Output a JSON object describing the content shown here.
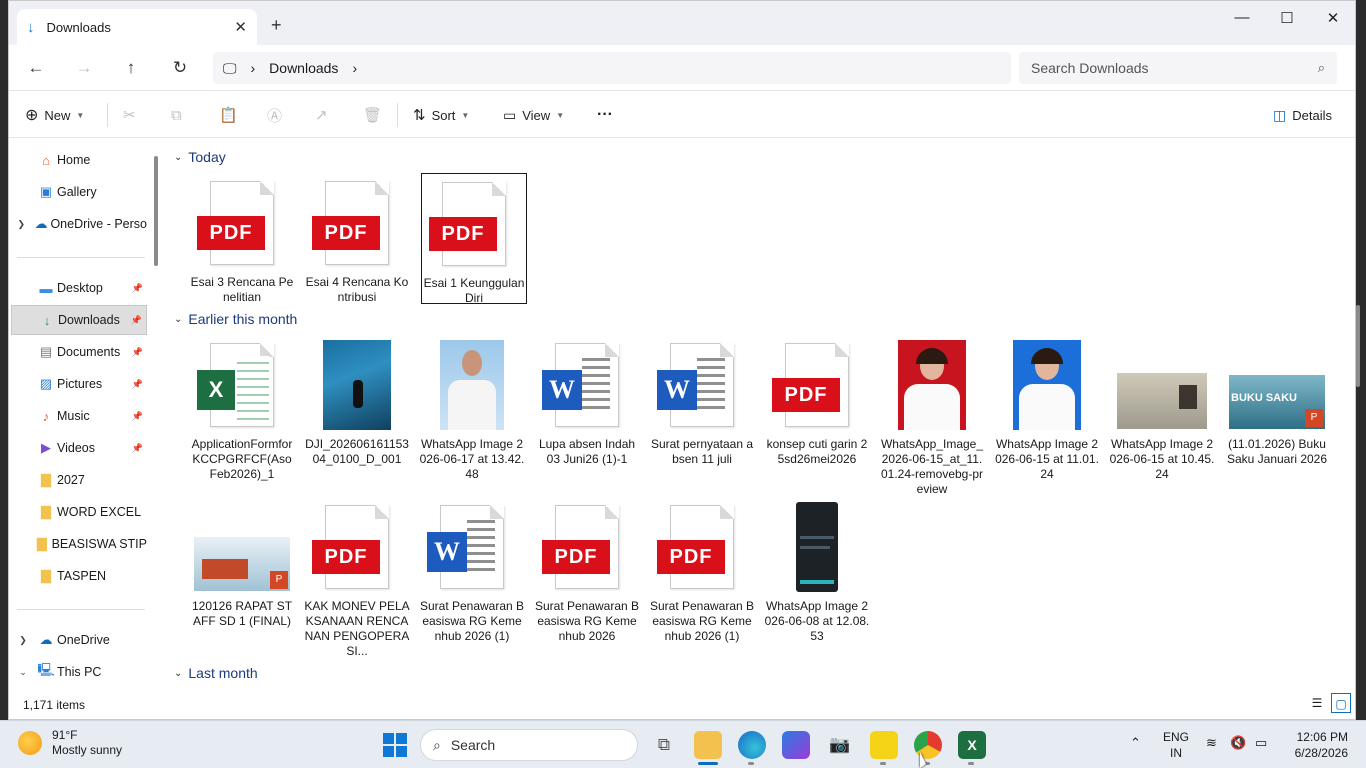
{
  "window": {
    "tab_title": "Downloads",
    "new_tab_icon": "plus-icon",
    "controls": [
      "minimize",
      "maximize",
      "close"
    ]
  },
  "address": {
    "breadcrumb": [
      "Downloads"
    ],
    "search_placeholder": "Search Downloads"
  },
  "toolbar": {
    "new_label": "New",
    "sort_label": "Sort",
    "view_label": "View",
    "details_label": "Details",
    "more_label": "···"
  },
  "sidebar": {
    "items": [
      {
        "label": "Home",
        "icon": "home-icon",
        "color": "#e0662f"
      },
      {
        "label": "Gallery",
        "icon": "gallery-icon",
        "color": "#2a7fd4"
      },
      {
        "label": "OneDrive - Perso",
        "icon": "cloud-icon",
        "color": "#0f6cbd"
      },
      {
        "label": "Desktop",
        "icon": "desktop-icon",
        "color": "#3b8fe0"
      },
      {
        "label": "Downloads",
        "icon": "download-icon",
        "color": "#1f9c56"
      },
      {
        "label": "Documents",
        "icon": "documents-icon",
        "color": "#6c7a8a"
      },
      {
        "label": "Pictures",
        "icon": "pictures-icon",
        "color": "#2d7fd6"
      },
      {
        "label": "Music",
        "icon": "music-icon",
        "color": "#e05a3d"
      },
      {
        "label": "Videos",
        "icon": "videos-icon",
        "color": "#7a4fd1"
      },
      {
        "label": "2027",
        "icon": "folder-icon",
        "color": "#f2c14e"
      },
      {
        "label": "WORD EXCEL",
        "icon": "folder-icon",
        "color": "#f2c14e"
      },
      {
        "label": "BEASISWA STIP",
        "icon": "folder-icon",
        "color": "#f2c14e"
      },
      {
        "label": "TASPEN",
        "icon": "folder-icon",
        "color": "#f2c14e"
      },
      {
        "label": "OneDrive",
        "icon": "cloud-icon",
        "color": "#0f6cbd"
      },
      {
        "label": "This PC",
        "icon": "pc-icon",
        "color": "#2d7fd6"
      }
    ]
  },
  "groups": {
    "today": "Today",
    "earlier": "Earlier this month",
    "last": "Last month"
  },
  "files": {
    "today": [
      {
        "name": "Esai 3 Rencana Penelitian",
        "type": "pdf"
      },
      {
        "name": "Esai 4 Rencana Kontribusi",
        "type": "pdf"
      },
      {
        "name": "Esai 1 Keunggulan Diri",
        "type": "pdf",
        "selected": true
      }
    ],
    "earlier_row1": [
      {
        "name": "ApplicationFormforKCCPGRFCF(AsoFeb2026)_1",
        "type": "xlsx"
      },
      {
        "name": "DJI_20260616115304_0100_D_001",
        "type": "photo-pool"
      },
      {
        "name": "WhatsApp Image 2026-06-17 at 13.42.48",
        "type": "photo-uniform"
      },
      {
        "name": "Lupa absen Indah 03 Juni26 (1)-1",
        "type": "docx"
      },
      {
        "name": "Surat pernyataan absen 11 juli",
        "type": "docx"
      },
      {
        "name": "konsep cuti garin 25sd26mei2026",
        "type": "pdf"
      },
      {
        "name": "WhatsApp_Image_2026-06-15_at_11.01.24-removebg-preview",
        "type": "photo-red"
      },
      {
        "name": "WhatsApp Image 2026-06-15 at 11.01.24",
        "type": "photo-blue"
      },
      {
        "name": "WhatsApp Image 2026-06-15 at 10.45.24",
        "type": "photo-card"
      },
      {
        "name": "(11.01.2026) Buku Saku Januari 2026",
        "type": "pptx-book"
      }
    ],
    "earlier_row2": [
      {
        "name": "120126 RAPAT STAFF SD 1 (FINAL)",
        "type": "pptx-ship"
      },
      {
        "name": "KAK MONEV PELAKSANAAN RENCANAN PENGOPERASI...",
        "type": "pdf"
      },
      {
        "name": "Surat Penawaran Beasiswa RG Kemenhub 2026 (1)",
        "type": "docx"
      },
      {
        "name": "Surat Penawaran Beasiswa RG Kemenhub 2026",
        "type": "pdf"
      },
      {
        "name": "Surat Penawaran Beasiswa RG Kemenhub 2026 (1)",
        "type": "pdf"
      },
      {
        "name": "WhatsApp Image 2026-06-08 at 12.08.53",
        "type": "photo-phone"
      }
    ],
    "pdf_badge": "PDF",
    "word_badge": "W",
    "excel_badge": "X",
    "book_text": "BUKU SAKU"
  },
  "status": {
    "count": "1,171 items"
  },
  "taskbar": {
    "temp": "91°F",
    "condition": "Mostly sunny",
    "search_label": "Search",
    "lang1": "ENG",
    "lang2": "IN",
    "time": "12:06 PM",
    "date": "6/28/2026"
  }
}
